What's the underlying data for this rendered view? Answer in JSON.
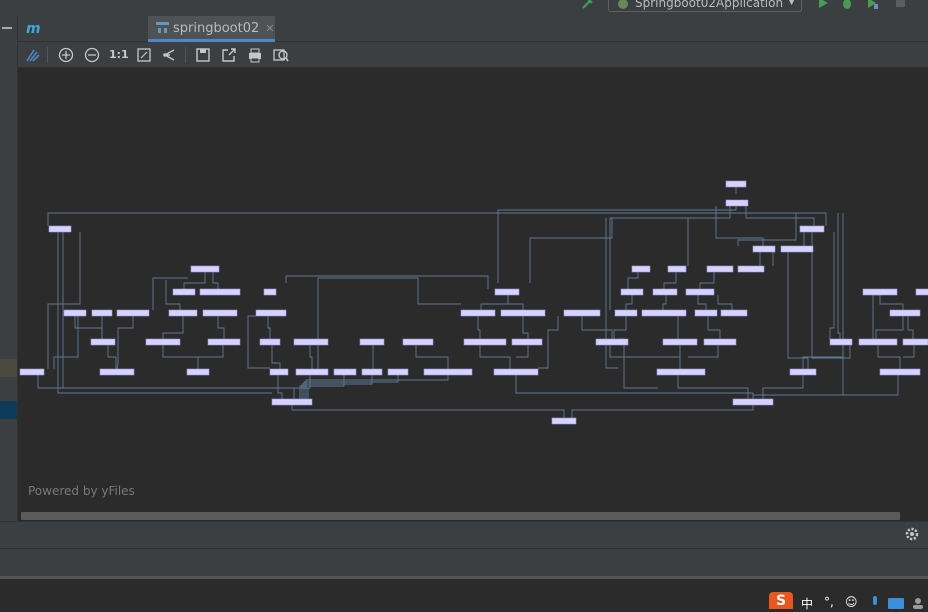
{
  "run_toolbar": {
    "config_label": "Springboot02Application",
    "config_icon": "spring-boot-icon",
    "buttons": [
      "run-icon",
      "debug-icon",
      "coverage-icon",
      "stop-icon"
    ]
  },
  "tabs": [
    {
      "label": "springboot02",
      "icon": "maven-icon",
      "active": false
    },
    {
      "label": "springboot02",
      "icon": "diagram-icon",
      "active": true
    }
  ],
  "diagram_toolbar": {
    "one_to_one": "1:1",
    "buttons": [
      "layout-icon",
      "zoom-in-icon",
      "zoom-out-icon",
      "actual-size-icon",
      "fit-content-icon",
      "layout-tree-icon",
      "save-icon",
      "export-icon",
      "print-icon",
      "print-preview-icon"
    ]
  },
  "canvas": {
    "powered_by": "Powered by yFiles",
    "node_color": "#d7d3ff",
    "edge_color": "#5f7a96"
  },
  "colors": {
    "background": "#2b2b2b",
    "panel": "#3c3f41",
    "accent": "#4a88c7"
  },
  "tray": {
    "ime_logo": "S",
    "items": [
      "中",
      "°,",
      "☺",
      "mic-icon",
      "keyboard-icon",
      "user-icon"
    ]
  }
}
